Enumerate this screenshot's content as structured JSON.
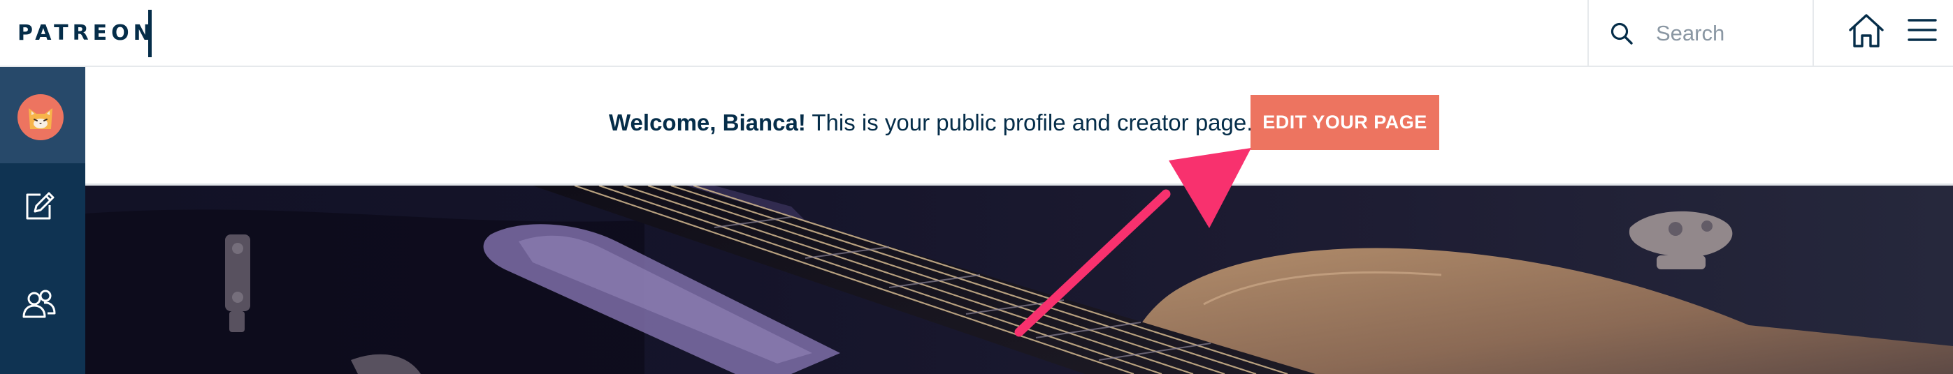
{
  "app": {
    "logo_text": "PATREON"
  },
  "header": {
    "search": {
      "placeholder": "Search",
      "value": ""
    },
    "home_icon": "house-icon",
    "menu_icon": "hamburger-menu-icon"
  },
  "sidebar": {
    "items": [
      {
        "icon": "cat-avatar",
        "active": true
      },
      {
        "icon": "edit-post-icon",
        "active": false
      },
      {
        "icon": "community-icon",
        "active": false
      }
    ]
  },
  "banner": {
    "greeting": "Welcome, Bianca!",
    "message": " This is your public profile and creator page.",
    "edit_button_label": "EDIT YOUR PAGE"
  },
  "cover": {
    "description_icon": "acoustic-guitar-cover-photo"
  },
  "colors": {
    "navy": "#052d49",
    "rail": "#0f3352",
    "rail_active": "#27496a",
    "accent": "#ed7460",
    "annotation_arrow": "#f8316e"
  }
}
